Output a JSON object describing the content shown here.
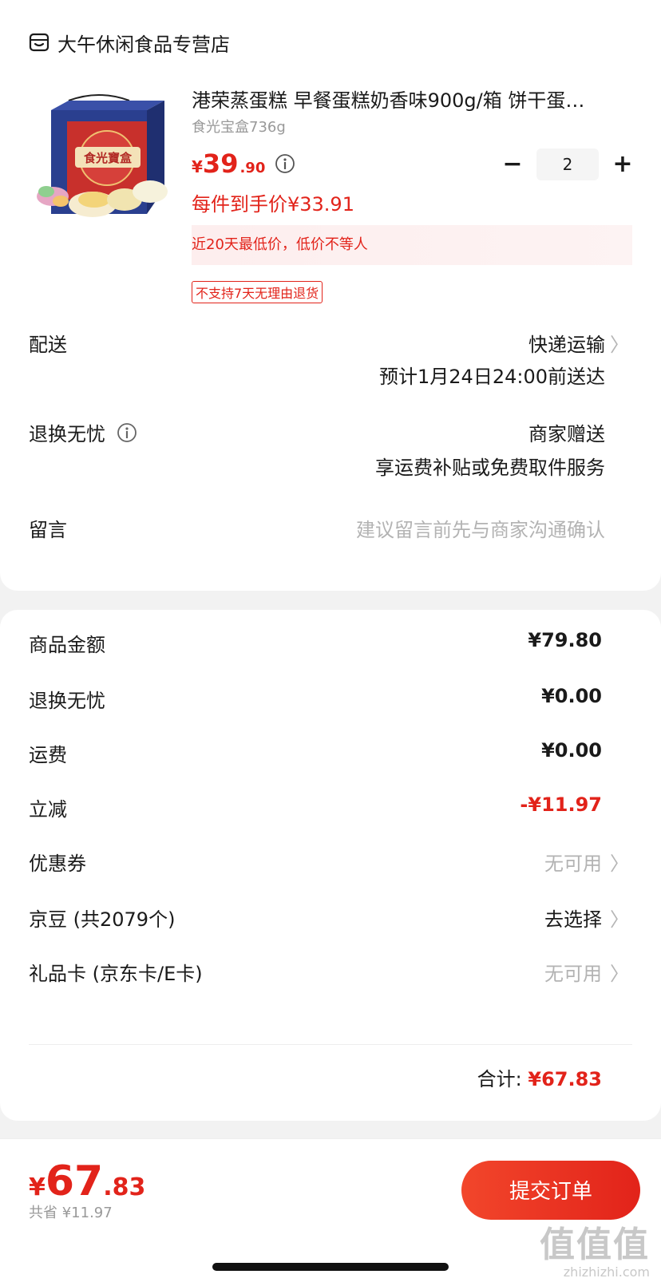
{
  "store": {
    "name": "大午休闲食品专营店",
    "icon": "store-icon"
  },
  "product": {
    "title": "港荣蒸蛋糕 早餐蛋糕奶香味900g/箱 饼干蛋…",
    "image_text": "食光寶盒",
    "spec": "食光宝盒736g",
    "price_currency": "¥",
    "price_int": "39",
    "price_dec": ".90",
    "quantity": "2",
    "qty_minus": "−",
    "qty_plus": "+",
    "unit_price": "每件到手价¥33.91",
    "lowest_banner": "近20天最低价，低价不等人",
    "no_return_tag": "不支持7天无理由退货"
  },
  "delivery": {
    "label": "配送",
    "method": "快递运输",
    "eta": "预计1月24日24:00前送达"
  },
  "return_service": {
    "label": "退换无忧",
    "provider": "商家赠送",
    "desc": "享运费补贴或免费取件服务"
  },
  "message": {
    "label": "留言",
    "placeholder": "建议留言前先与商家沟通确认"
  },
  "price_summary": {
    "goods_label": "商品金额",
    "goods_value": "¥79.80",
    "return_label": "退换无忧",
    "return_value": "¥0.00",
    "shipping_label": "运费",
    "shipping_value": "¥0.00",
    "discount_label": "立减",
    "discount_value": "-¥11.97",
    "coupon_label": "优惠券",
    "coupon_value": "无可用",
    "jingdou_label": "京豆 (共2079个)",
    "jingdou_value": "去选择",
    "giftcard_label": "礼品卡 (京东卡/E卡)",
    "giftcard_value": "无可用",
    "subtotal_label": "合计:",
    "subtotal_value": "¥67.83"
  },
  "bottom": {
    "total_currency": "¥",
    "total_int": "67",
    "total_dec": ".83",
    "saved": "共省 ¥11.97",
    "submit_label": "提交订单"
  },
  "watermark": {
    "glyphs": "值值值",
    "url": "zhizhizhi.com"
  },
  "colors": {
    "accent": "#e2231a",
    "muted": "#999999",
    "background": "#f2f2f2"
  }
}
